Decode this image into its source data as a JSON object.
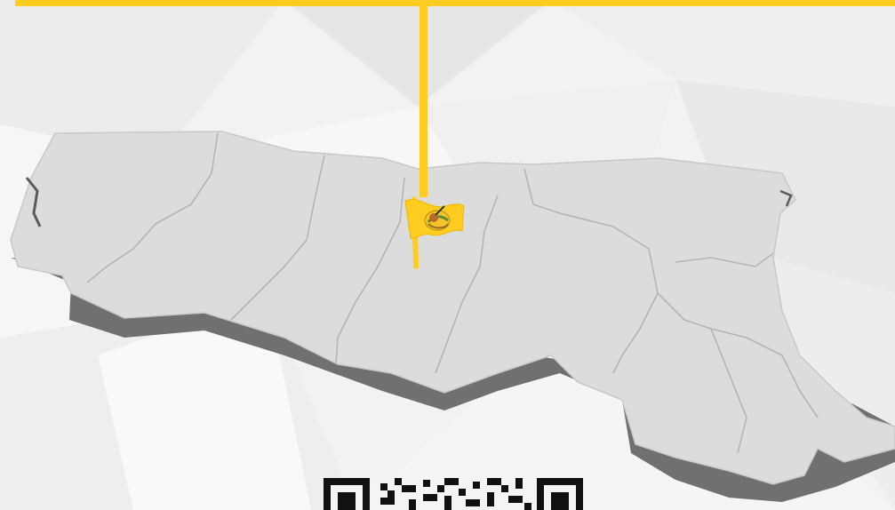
{
  "colors": {
    "accent": "#ffcc1f",
    "region_fill": "#dcdcdc",
    "region_shadow": "#6e6e6e",
    "border_line": "#b4b4b4",
    "background": "#f3f3f3"
  },
  "map": {
    "region": "Emilia-Romagna",
    "provinces_count": 9,
    "marker_icon": "flag-with-emblem-icon"
  },
  "qr": {
    "icon": "qr-code-icon"
  }
}
